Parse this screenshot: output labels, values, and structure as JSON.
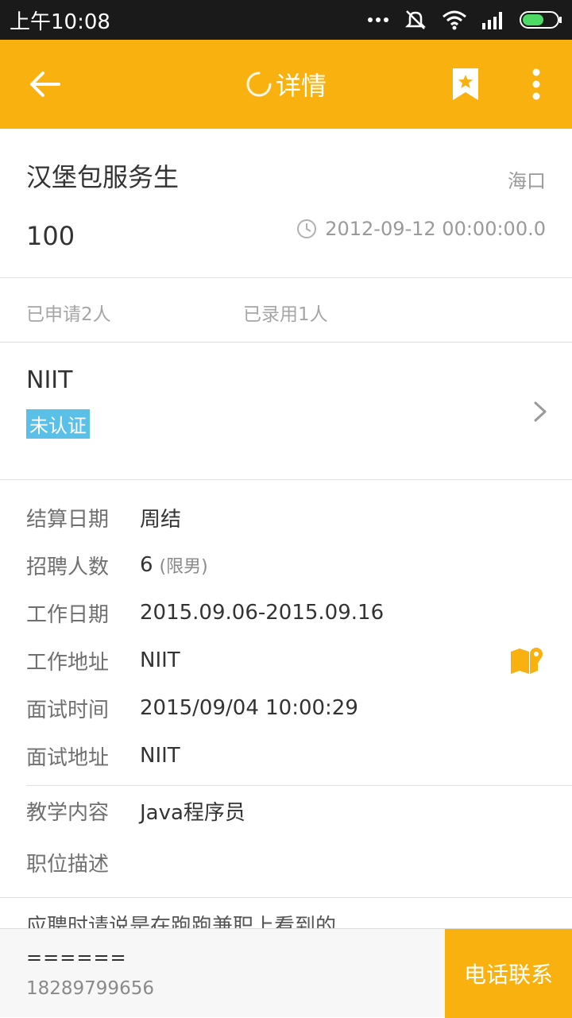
{
  "status_bar": {
    "time": "上午10:08"
  },
  "app_bar": {
    "title": "详情"
  },
  "job": {
    "title": "汉堡包服务生",
    "city": "海口",
    "salary": "100",
    "date": "2012-09-12 00:00:00.0"
  },
  "stats": {
    "applied": "已申请2人",
    "hired": "已录用1人"
  },
  "company": {
    "name": "NIIT",
    "cert_status": "未认证"
  },
  "details": [
    {
      "label": "结算日期",
      "value": "周结",
      "sub": ""
    },
    {
      "label": "招聘人数",
      "value": "6",
      "sub": "(限男)"
    },
    {
      "label": "工作日期",
      "value": "2015.09.06-2015.09.16",
      "sub": ""
    },
    {
      "label": "工作地址",
      "value": "NIIT",
      "sub": ""
    },
    {
      "label": "面试时间",
      "value": "2015/09/04 10:00:29",
      "sub": ""
    },
    {
      "label": "面试地址",
      "value": "NIIT",
      "sub": ""
    },
    {
      "label": "教学内容",
      "value": "Java程序员",
      "sub": ""
    },
    {
      "label": "职位描述",
      "value": "",
      "sub": ""
    }
  ],
  "description": "应聘时请说是在跑跑兼职上看到的",
  "contact": {
    "name": "======",
    "phone": "18289799656",
    "call_label": "电话联系"
  },
  "colors": {
    "accent": "#f9b10f",
    "badge": "#5bc0e8"
  }
}
